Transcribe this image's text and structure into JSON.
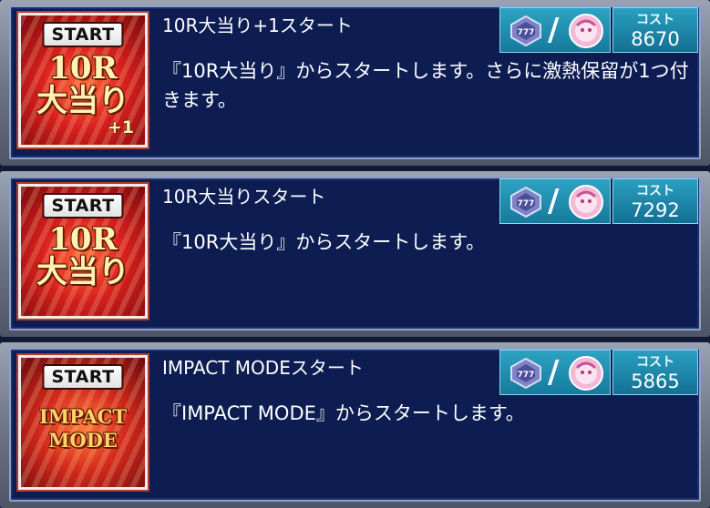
{
  "items": [
    {
      "badge": "START",
      "thumb_text": "10R\n大当り",
      "thumb_plus": "+1",
      "title": "10R大当り+1スタート",
      "description": "『10R大当り』からスタートします。さらに激熱保留が1つ付きます。",
      "cost_label": "コスト",
      "cost_value": "8670",
      "slash": "/"
    },
    {
      "badge": "START",
      "thumb_text": "10R\n大当り",
      "title": "10R大当りスタート",
      "description": "『10R大当り』からスタートします。",
      "cost_label": "コスト",
      "cost_value": "7292",
      "slash": "/"
    },
    {
      "badge": "START",
      "thumb_text": "IMPACT\nMODE",
      "title": "IMPACT MODEスタート",
      "description": "『IMPACT MODE』からスタートします。",
      "cost_label": "コスト",
      "cost_value": "5865",
      "slash": "/"
    }
  ],
  "icons": {
    "gem": "gem-icon",
    "character": "character-icon"
  },
  "colors": {
    "panel_bg": "#0d1d52",
    "cost_box": "#1f8fb3",
    "thumb_red": "#d81f1f"
  }
}
